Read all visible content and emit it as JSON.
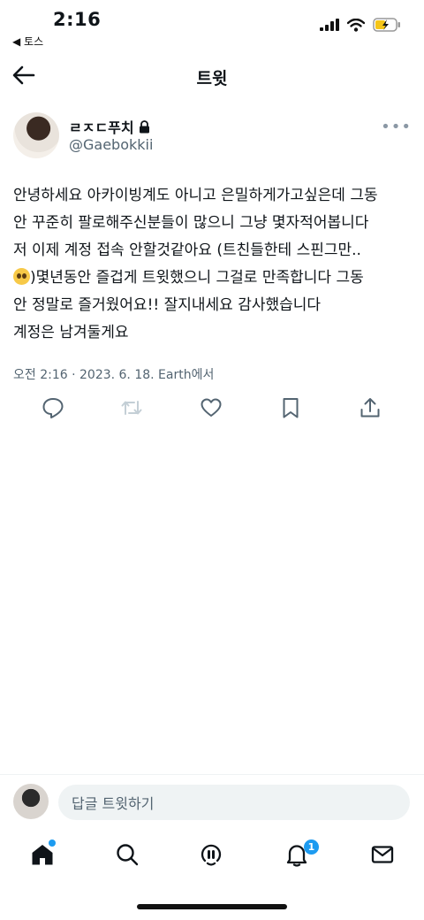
{
  "status_bar": {
    "time": "2:16",
    "back_app": "◀ 토스",
    "battery": "charging"
  },
  "nav": {
    "title": "트윗"
  },
  "author": {
    "name": "ㄹㅈㄷ푸치",
    "handle": "@Gaebokkii",
    "protected": true
  },
  "tweet": {
    "lines": [
      "안녕하세요 아카이빙계도 아니고 은밀하게가고싶은데 그동",
      "안 꾸준히 팔로해주신분들이 많으니 그냥 몇자적어봅니다",
      "저 이제 계정 접속 안할것같아요 (트친들한테 스핀그만..",
      ")몇년동안 즐겁게 트윗했으니 그걸로 만족합니다 그동",
      "안 정말로 즐거웠어요!! 잘지내세요 감사했습니다",
      "계정은 남겨둘게요"
    ],
    "meta": "오전 2:16 · 2023. 6. 18. Earth에서"
  },
  "actions": [
    "reply-icon",
    "retweet-icon",
    "like-icon",
    "bookmark-icon",
    "share-icon"
  ],
  "reply": {
    "placeholder": "답글 트윗하기"
  },
  "bottom_nav": {
    "tabs": [
      "home-icon",
      "search-icon",
      "spaces-icon",
      "notifications-icon",
      "messages-icon"
    ],
    "notification_count": "1"
  },
  "colors": {
    "accent": "#1d9bf0",
    "text": "#0f1419",
    "secondary": "#536471"
  }
}
